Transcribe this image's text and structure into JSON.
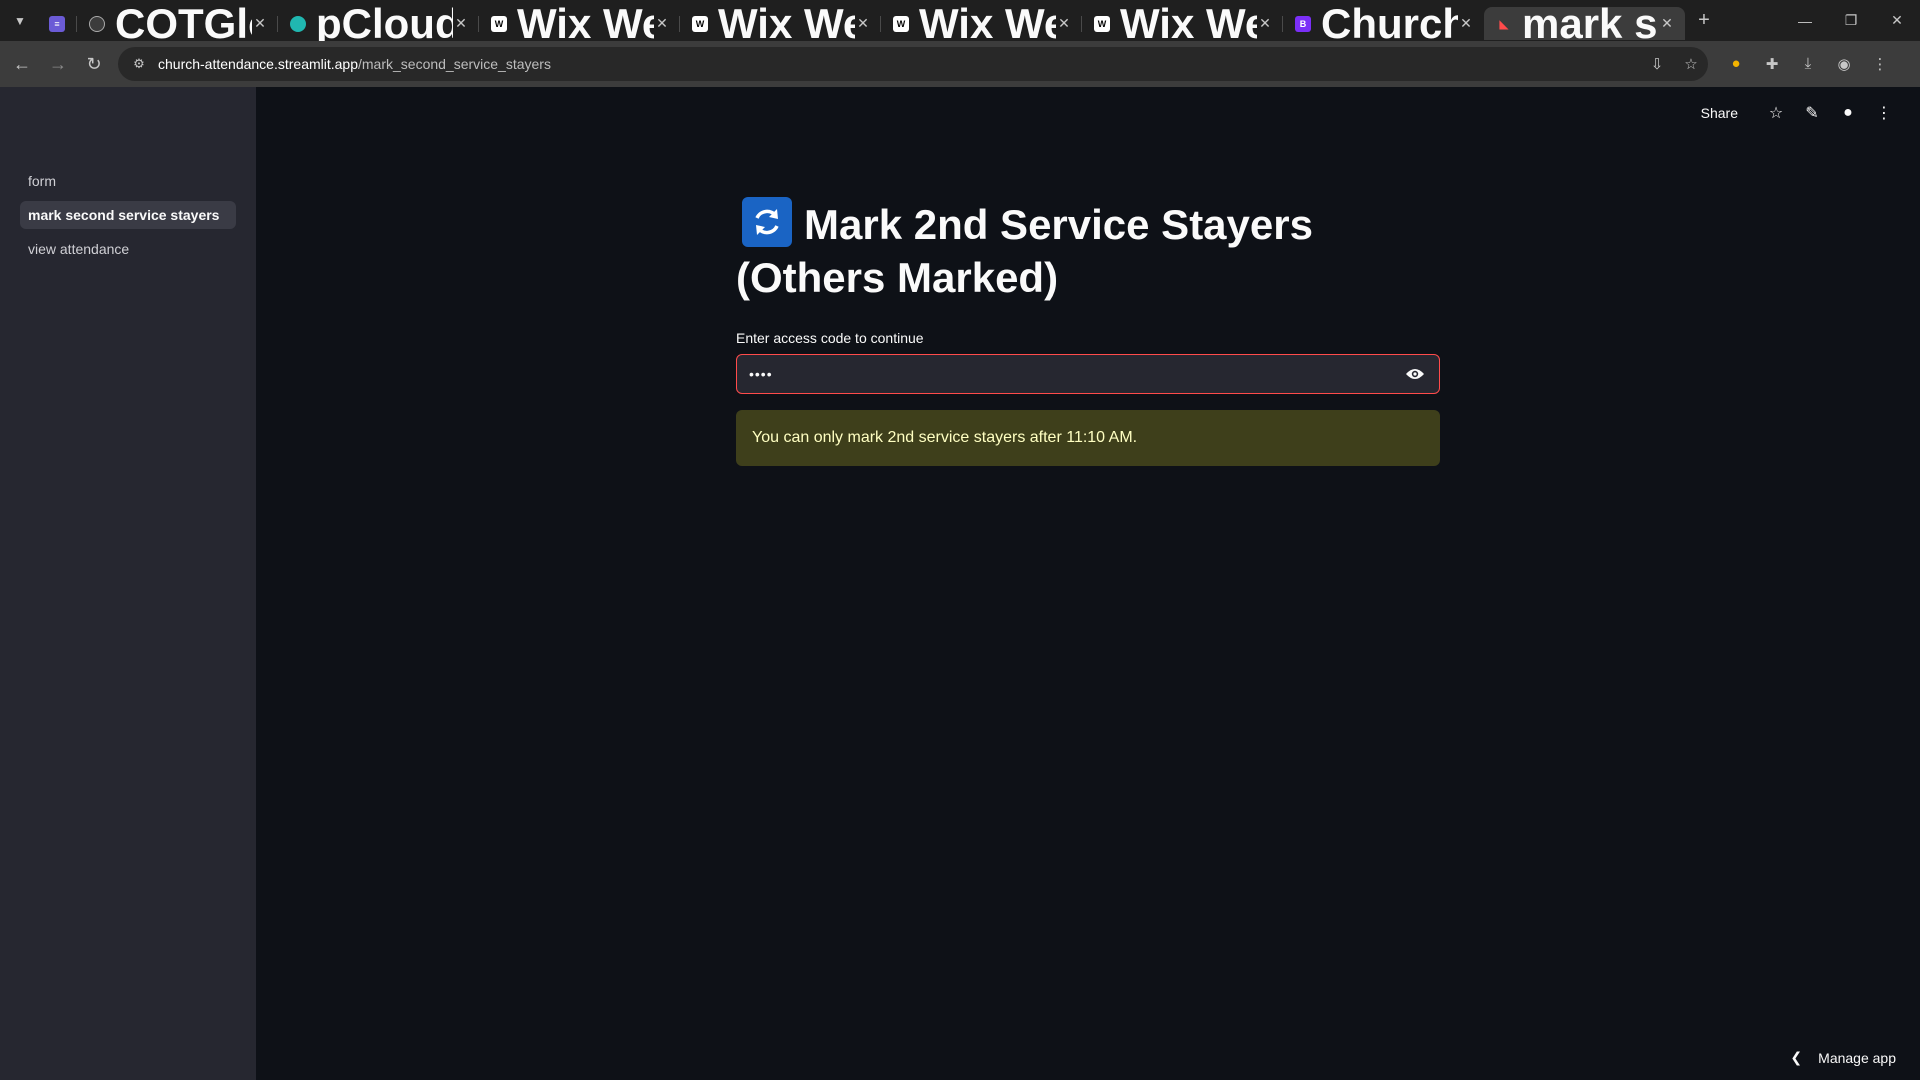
{
  "browser": {
    "tabs": [
      {
        "title": "",
        "favicon": "list-icon",
        "color": "#6b5bd6"
      },
      {
        "title": "COTGlobal Audio Library",
        "favicon": "globe-icon",
        "color": "#3c3c3c"
      },
      {
        "title": "pCloud :: File Manager",
        "favicon": "cloud-icon",
        "color": "#20b7b0"
      },
      {
        "title": "Wix Website Editor | My",
        "favicon": "wix-icon",
        "color": "#ffffff"
      },
      {
        "title": "Wix Website Editor | My",
        "favicon": "wix-icon",
        "color": "#ffffff"
      },
      {
        "title": "Wix Website Editor | My",
        "favicon": "wix-icon",
        "color": "#ffffff"
      },
      {
        "title": "Wix Website Editor | My",
        "favicon": "wix-icon",
        "color": "#ffffff"
      },
      {
        "title": "Church-Attendance-Syst",
        "favicon": "bootstrap-icon",
        "color": "#7b2ff7"
      },
      {
        "title": "mark second service stay",
        "favicon": "streamlit-icon",
        "color": "#ff4b4b"
      }
    ],
    "url_host": "church-attendance.streamlit.app",
    "url_path": "/mark_second_service_stayers"
  },
  "sidebar": {
    "items": [
      {
        "label": "form",
        "active": false
      },
      {
        "label": "mark second service stayers",
        "active": true
      },
      {
        "label": "view attendance",
        "active": false
      }
    ]
  },
  "header": {
    "share_label": "Share"
  },
  "main": {
    "title_line": "Mark 2nd Service Stayers (Others Marked)",
    "title_icon": "counterclockwise-arrows-icon",
    "input_label": "Enter access code to continue",
    "input_value": "••••",
    "warning": "You can only mark 2nd service stayers after 11:10 AM."
  },
  "footer": {
    "manage_label": "Manage app"
  },
  "colors": {
    "app_bg": "#0e1117",
    "sidebar_bg": "#262730",
    "error_border": "#ff4b4b",
    "warning_bg": "#3e3f1b",
    "warning_text": "#ffffc2"
  }
}
